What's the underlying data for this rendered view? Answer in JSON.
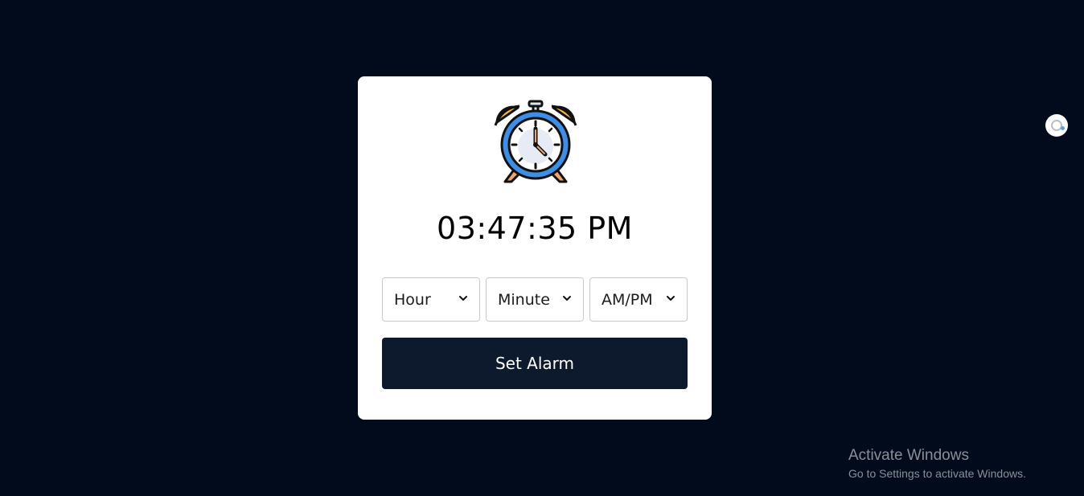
{
  "clock": {
    "time": "03:47:35 PM",
    "icon": "alarm-clock-icon"
  },
  "selects": {
    "hour": {
      "value": "Hour"
    },
    "minute": {
      "value": "Minute"
    },
    "ampm": {
      "value": "AM/PM"
    }
  },
  "button": {
    "label": "Set Alarm"
  },
  "watermark": {
    "title": "Activate Windows",
    "subtitle": "Go to Settings to activate Windows."
  },
  "colors": {
    "background": "#020b1c",
    "card": "#ffffff",
    "button": "#0d192c",
    "clock_ring": "#3f8ee6",
    "bells": "#f7b848"
  }
}
